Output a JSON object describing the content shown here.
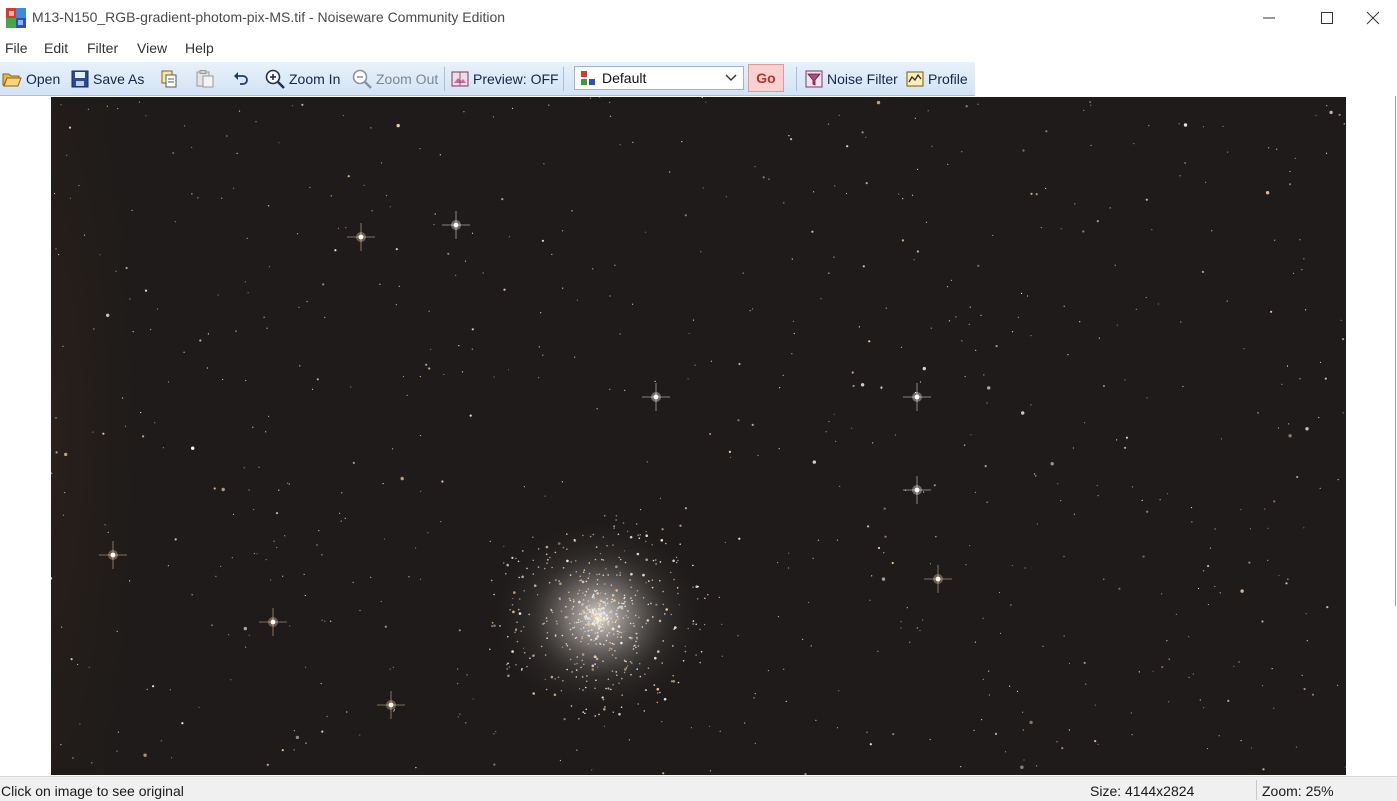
{
  "window": {
    "title": "M13-N150_RGB-gradient-photom-pix-MS.tif - Noiseware Community Edition"
  },
  "menu": {
    "items": [
      "File",
      "Edit",
      "Filter",
      "View",
      "Help"
    ]
  },
  "toolbar": {
    "open_label": "Open",
    "save_as_label": "Save As",
    "zoom_in_label": "Zoom In",
    "zoom_out_label": "Zoom Out",
    "preview_label": "Preview: OFF",
    "preset_value": "Default",
    "go_label": "Go",
    "noise_filter_label": "Noise Filter",
    "profile_label": "Profile"
  },
  "status": {
    "hint": "Click on image to see original",
    "size": "Size: 4144x2824",
    "zoom": "Zoom: 25%"
  },
  "colors": {
    "toolbar_bg": "#dce8f5",
    "go_button_bg": "#f7d2d0",
    "go_text": "#c0302a",
    "photo_bg": "#1d1a19"
  },
  "icons": [
    "app-icon",
    "open-folder-icon",
    "save-icon",
    "copy-icon",
    "paste-icon",
    "undo-icon",
    "zoom-in-icon",
    "zoom-out-icon",
    "preview-icon",
    "preset-icon",
    "chevron-down-icon",
    "noise-filter-icon",
    "profile-icon",
    "minimize-icon",
    "maximize-icon",
    "close-icon"
  ]
}
